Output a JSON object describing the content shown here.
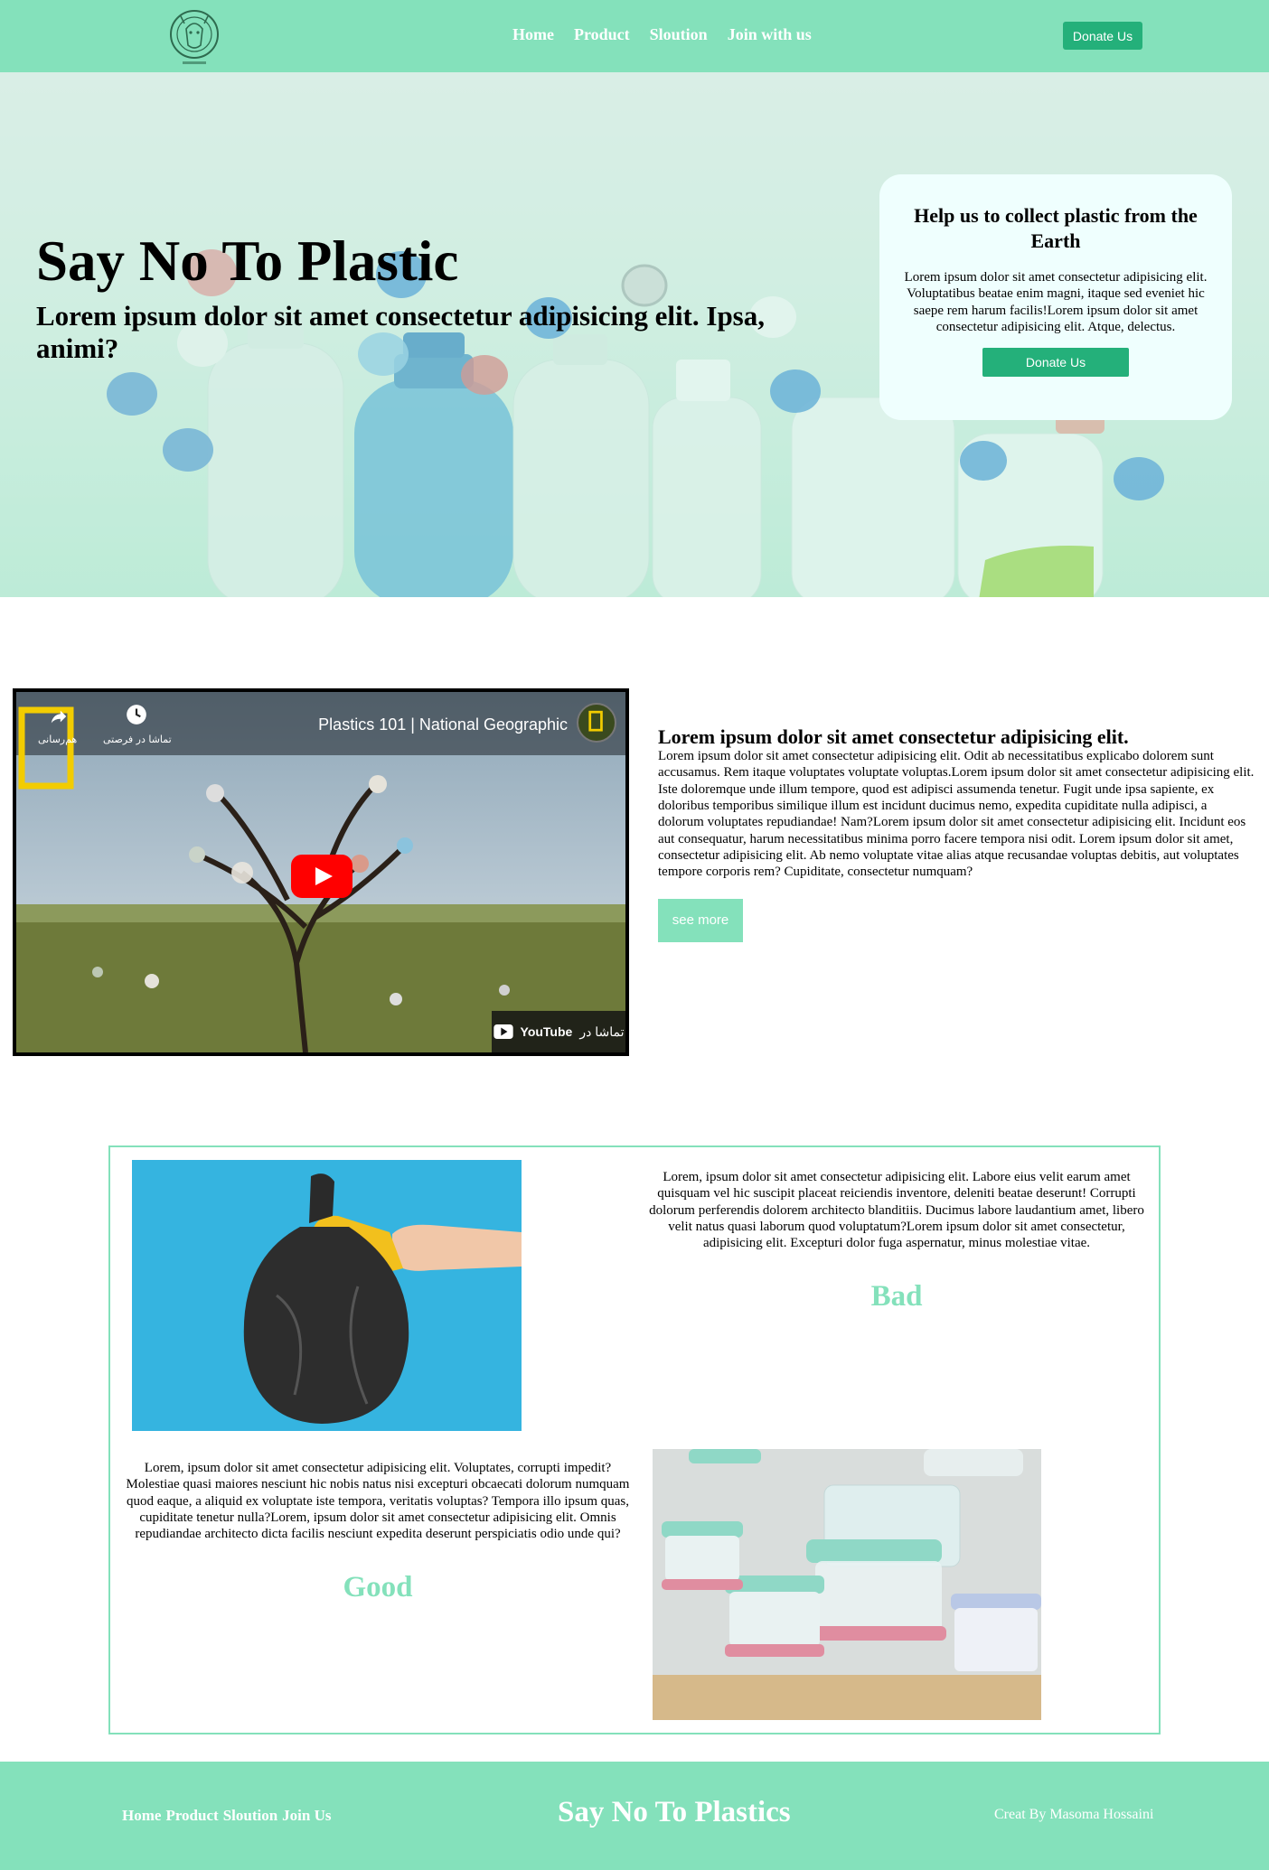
{
  "nav": {
    "links": [
      "Home",
      "Product",
      "Sloution",
      "Join with us"
    ],
    "donate_label": "Donate Us"
  },
  "hero": {
    "title": "Say No To Plastic",
    "subtitle": "Lorem ipsum dolor sit amet consectetur adipisicing elit. Ipsa, animi?"
  },
  "help_card": {
    "title": "Help us to collect plastic from the Earth",
    "text": "Lorem ipsum dolor sit amet consectetur adipisicing elit. Voluptatibus beatae enim magni, itaque sed eveniet hic saepe rem harum facilis!Lorem ipsum dolor sit amet consectetur adipisicing elit. Atque, delectus.",
    "button_label": "Donate Us"
  },
  "video": {
    "title": "Plastics 101 | National Geographic",
    "share_label": "هم‌رسانی",
    "watch_later_label": "تماشا در فرصتی",
    "watch_on_label": "تماشا در",
    "platform": "YouTube"
  },
  "about": {
    "title": "Lorem ipsum dolor sit amet consectetur adipisicing elit.",
    "text": "Lorem ipsum dolor sit amet consectetur adipisicing elit. Odit ab necessitatibus explicabo dolorem sunt accusamus. Rem itaque voluptates voluptate voluptas.Lorem ipsum dolor sit amet consectetur adipisicing elit. Iste doloremque unde illum tempore, quod est adipisci assumenda tenetur. Fugit unde ipsa sapiente, ex doloribus temporibus similique illum est incidunt ducimus nemo, expedita cupiditate nulla adipisci, a dolorum voluptates repudiandae! Nam?Lorem ipsum dolor sit amet consectetur adipisicing elit. Incidunt eos aut consequatur, harum necessitatibus minima porro facere tempora nisi odit. Lorem ipsum dolor sit amet, consectetur adipisicing elit. Ab nemo voluptate vitae alias atque recusandae voluptas debitis, aut voluptates tempore corporis rem? Cupiditate, consectetur numquam?",
    "button_label": "see more"
  },
  "compare": {
    "bad": {
      "text": "Lorem, ipsum dolor sit amet consectetur adipisicing elit. Labore eius velit earum amet quisquam vel hic suscipit placeat reiciendis inventore, deleniti beatae deserunt! Corrupti dolorum perferendis dolorem architecto blanditiis. Ducimus labore laudantium amet, libero velit natus quasi laborum quod voluptatum?Lorem ipsum dolor sit amet consectetur, adipisicing elit. Excepturi dolor fuga aspernatur, minus molestiae vitae.",
      "label": "Bad"
    },
    "good": {
      "text": "Lorem, ipsum dolor sit amet consectetur adipisicing elit. Voluptates, corrupti impedit? Molestiae quasi maiores nesciunt hic nobis natus nisi excepturi obcaecati dolorum numquam quod eaque, a aliquid ex voluptate iste tempora, veritatis voluptas? Tempora illo ipsum quas, cupiditate tenetur nulla?Lorem, ipsum dolor sit amet consectetur adipisicing elit. Omnis repudiandae architecto dicta facilis nesciunt expedita deserunt perspiciatis odio unde qui?",
      "label": "Good"
    }
  },
  "footer": {
    "links": [
      "Home",
      "Product",
      "Sloution",
      "Join Us"
    ],
    "title": "Say No To Plastics",
    "credit": "Creat By Masoma Hossaini"
  },
  "colors": {
    "brand_mint": "#84e1bb",
    "button_green": "#24b07a",
    "card_bg": "#effffe"
  }
}
